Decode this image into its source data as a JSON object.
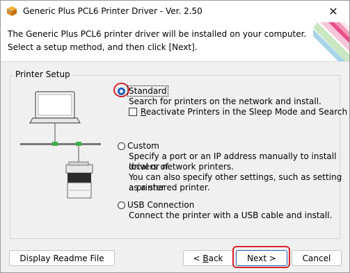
{
  "window": {
    "title": "Generic Plus PCL6 Printer Driver - Ver. 2.50",
    "close_icon": "close-icon",
    "app_icon": "package-icon"
  },
  "header": {
    "line1": "The Generic Plus PCL6 printer driver will be installed on your computer.",
    "line2": "Select a setup method, and then click [Next]."
  },
  "printer_setup": {
    "group_label": "Printer Setup",
    "options": [
      {
        "label": "Standard",
        "selected": true,
        "description": [
          "Search for printers on the network and install."
        ]
      },
      {
        "label": "Custom",
        "selected": false,
        "description": [
          "Specify a port or an IP address manually to install drivers of",
          "local or network printers.",
          "You can also specify other settings, such as setting a printer",
          "as a shared printer."
        ]
      },
      {
        "label": "USB Connection",
        "selected": false,
        "description": [
          "Connect the printer with a USB cable and install."
        ]
      }
    ],
    "reactivate_checkbox": {
      "prefix": "R",
      "rest": "eactivate Printers in the Sleep Mode and Search",
      "checked": false
    }
  },
  "buttons": {
    "readme": "Display Readme File",
    "back_prefix": "< ",
    "back_u": "B",
    "back_rest": "ack",
    "next": "Next >",
    "cancel": "Cancel"
  },
  "colors": {
    "highlight_ring": "#d8232a",
    "accent": "#1e5fbf"
  }
}
